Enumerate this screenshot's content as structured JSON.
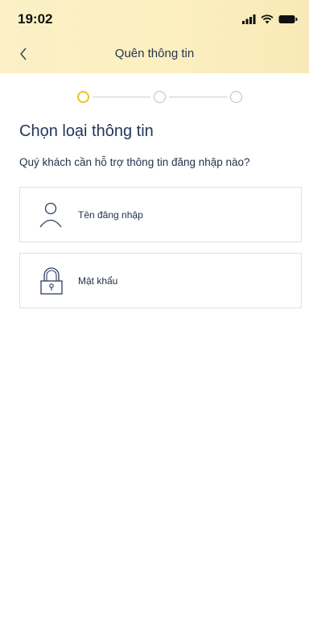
{
  "status_bar": {
    "time": "19:02",
    "icons": [
      "signal-icon",
      "wifi-icon",
      "battery-icon"
    ]
  },
  "nav": {
    "title": "Quên thông tin",
    "back_icon": "chevron-left-icon"
  },
  "stepper": {
    "steps": 3,
    "current": 1,
    "active_color": "#f0c020"
  },
  "content": {
    "title": "Chọn loại thông tin",
    "subtitle": "Quý khách cần hỗ trợ thông tin đăng nhập nào?"
  },
  "options": [
    {
      "label": "Tên đăng nhập",
      "icon": "user-icon"
    },
    {
      "label": "Mật khẩu",
      "icon": "lock-icon"
    }
  ],
  "colors": {
    "header_bg": "#fcefc0",
    "title_text": "#23365b",
    "card_border": "#dde1e7"
  }
}
